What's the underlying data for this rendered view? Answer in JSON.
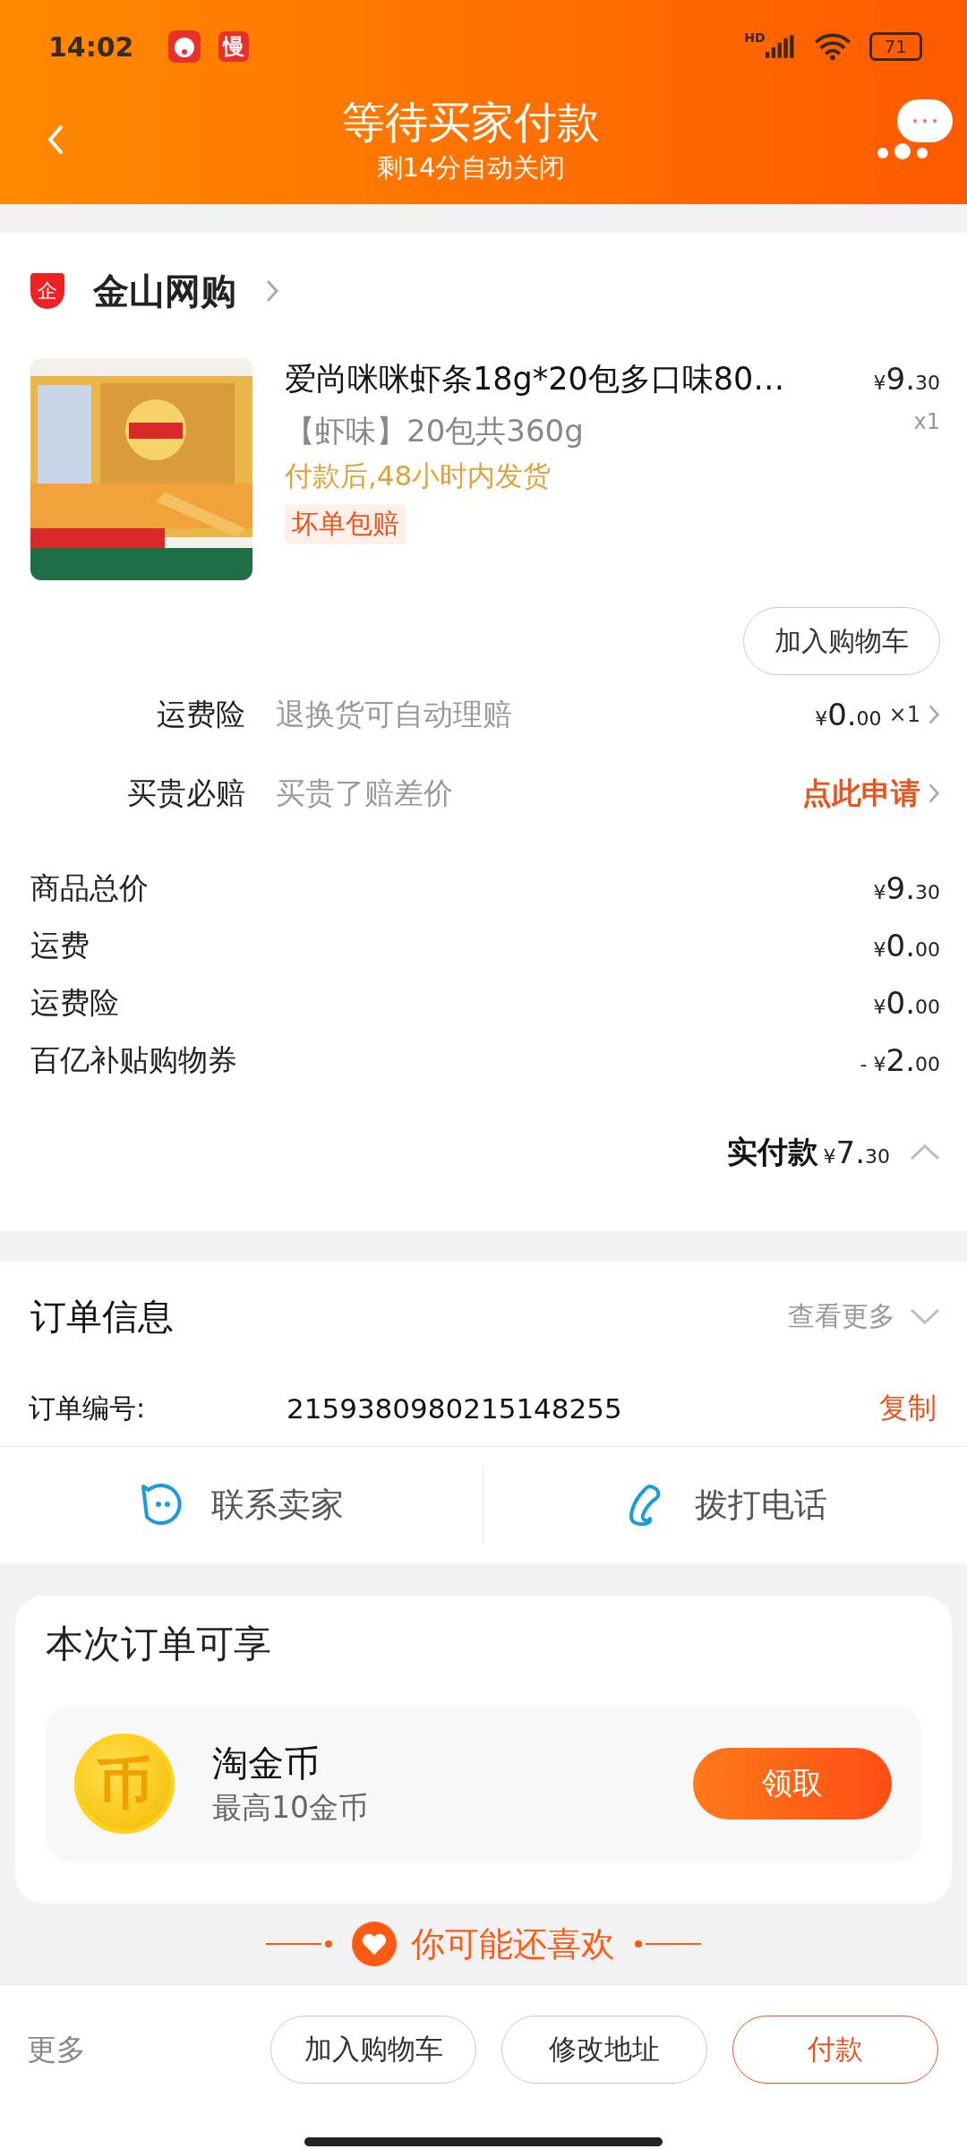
{
  "status_bar": {
    "time": "14:02",
    "app_badge": "慢",
    "network": "HD",
    "battery": "71"
  },
  "header": {
    "title": "等待买家付款",
    "subtitle": "剩14分自动关闭"
  },
  "shop": {
    "badge": "企",
    "name": "金山网购"
  },
  "product": {
    "kind": "picture",
    "title": "爱尚咪咪虾条18g*20包多口味80…",
    "price": {
      "currency": "¥",
      "main": "9.",
      "cents": "30"
    },
    "quantity": "x1",
    "variant": "【虾味】20包共360g",
    "shipping": "付款后,48小时内发货",
    "tag": "坏单包赔",
    "add_cart": "加入购物车"
  },
  "services": [
    {
      "kind": "price",
      "label": "运费险",
      "desc": "退换货可自动理赔",
      "price": {
        "currency": "¥",
        "main": "0.",
        "cents": "00"
      },
      "qty": "×1"
    },
    {
      "kind": "link",
      "label": "买贵必赔",
      "desc": "买贵了赔差价",
      "action": "点此申请"
    }
  ],
  "summary": [
    {
      "label": "商品总价",
      "price": {
        "currency": "¥",
        "main": "9.",
        "cents": "30"
      }
    },
    {
      "label": "运费",
      "price": {
        "currency": "¥",
        "main": "0.",
        "cents": "00"
      }
    },
    {
      "label": "运费险",
      "price": {
        "currency": "¥",
        "main": "0.",
        "cents": "00"
      }
    },
    {
      "label": "百亿补贴购物券",
      "sign": "-",
      "price": {
        "currency": "¥",
        "main": "2.",
        "cents": "00"
      }
    }
  ],
  "total": {
    "label": "实付款",
    "price": {
      "currency": "¥",
      "main": "7.",
      "cents": "30"
    },
    "expanded": true
  },
  "order_info": {
    "title": "订单信息",
    "more": "查看更多",
    "expanded": false,
    "number_label": "订单编号:",
    "number": "2159380980215148255",
    "copy": "复制"
  },
  "contact": [
    {
      "kind": "chat",
      "label": "联系卖家"
    },
    {
      "kind": "phone",
      "label": "拨打电话"
    }
  ],
  "benefits": {
    "title": "本次订单可享",
    "items": [
      {
        "icon": "币",
        "name": "淘金币",
        "desc": "最高10金币",
        "button": "领取"
      }
    ]
  },
  "recommend": {
    "title": "你可能还喜欢"
  },
  "bottom_bar": {
    "more": "更多",
    "buttons": [
      {
        "label": "加入购物车",
        "kind": "outline"
      },
      {
        "label": "修改地址",
        "kind": "outline"
      },
      {
        "label": "付款",
        "kind": "accent"
      }
    ]
  }
}
